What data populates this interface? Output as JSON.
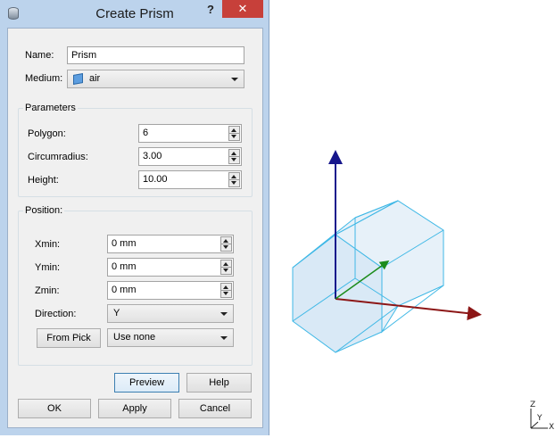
{
  "window": {
    "title": "Create Prism",
    "help_label": "?",
    "close_label": "✕"
  },
  "name": {
    "label": "Name:",
    "value": "Prism"
  },
  "medium": {
    "label": "Medium:",
    "value": "air",
    "icon": "cube-icon"
  },
  "parameters": {
    "title": "Parameters",
    "polygon": {
      "label": "Polygon:",
      "value": "6"
    },
    "circumradius": {
      "label": "Circumradius:",
      "value": "3.00"
    },
    "height": {
      "label": "Height:",
      "value": "10.00"
    }
  },
  "position": {
    "title": "Position:",
    "xmin": {
      "label": "Xmin:",
      "value": "0 mm"
    },
    "ymin": {
      "label": "Ymin:",
      "value": "0 mm"
    },
    "zmin": {
      "label": "Zmin:",
      "value": "0 mm"
    },
    "direction": {
      "label": "Direction:",
      "value": "Y"
    },
    "from_pick": {
      "label": "From Pick"
    },
    "pick_mode": {
      "value": "Use none"
    }
  },
  "buttons": {
    "preview": "Preview",
    "help": "Help",
    "ok": "OK",
    "apply": "Apply",
    "cancel": "Cancel"
  },
  "viewport": {
    "mini_axis": {
      "z": "Z",
      "y": "Y",
      "x": "X"
    },
    "colors": {
      "z_axis": "#16168c",
      "x_axis": "#8c1616",
      "y_axis": "#1c8c1c",
      "prism_edge": "#3fb8e6",
      "prism_fill": "#cfe4f4"
    }
  }
}
